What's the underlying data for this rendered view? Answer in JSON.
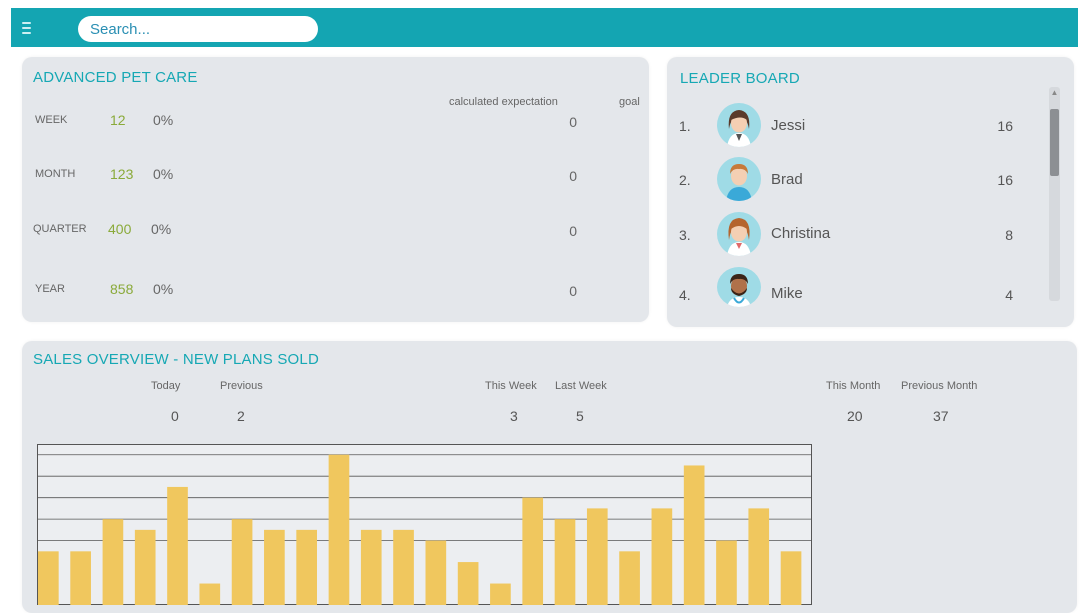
{
  "search": {
    "placeholder": "Search..."
  },
  "pet_care": {
    "title": "ADVANCED PET CARE",
    "col_calc": "calculated expectation",
    "col_goal": "goal",
    "rows": [
      {
        "period": "WEEK",
        "count": "12",
        "pct": "0%",
        "calc": "0"
      },
      {
        "period": "MONTH",
        "count": "123",
        "pct": "0%",
        "calc": "0"
      },
      {
        "period": "QUARTER",
        "count": "400",
        "pct": "0%",
        "calc": "0"
      },
      {
        "period": "YEAR",
        "count": "858",
        "pct": "0%",
        "calc": "0"
      }
    ]
  },
  "leaderboard": {
    "title": "LEADER BOARD",
    "entries": [
      {
        "rank": "1.",
        "name": "Jessi",
        "score": "16"
      },
      {
        "rank": "2.",
        "name": "Brad",
        "score": "16"
      },
      {
        "rank": "3.",
        "name": "Christina",
        "score": "8"
      },
      {
        "rank": "4.",
        "name": "Mike",
        "score": "4"
      }
    ]
  },
  "sales": {
    "title": "SALES OVERVIEW - NEW PLANS SOLD",
    "stats": [
      {
        "label": "Today",
        "value": "0"
      },
      {
        "label": "Previous",
        "value": "2"
      },
      {
        "label": "This Week",
        "value": "3"
      },
      {
        "label": "Last Week",
        "value": "5"
      },
      {
        "label": "This Month",
        "value": "20"
      },
      {
        "label": "Previous Month",
        "value": "37"
      }
    ]
  },
  "colors": {
    "accent": "#14a5b2",
    "bar": "#f0c75e",
    "count": "#8aaa3a"
  },
  "chart_data": {
    "type": "bar",
    "values": [
      2.5,
      2.5,
      4,
      3.5,
      5.5,
      1,
      4,
      3.5,
      3.5,
      7,
      3.5,
      3.5,
      3,
      2,
      1,
      5,
      4,
      4.5,
      2.5,
      4.5,
      6.5,
      3,
      4.5,
      2.5
    ],
    "ylim": [
      0,
      7.5
    ],
    "grid": true
  }
}
